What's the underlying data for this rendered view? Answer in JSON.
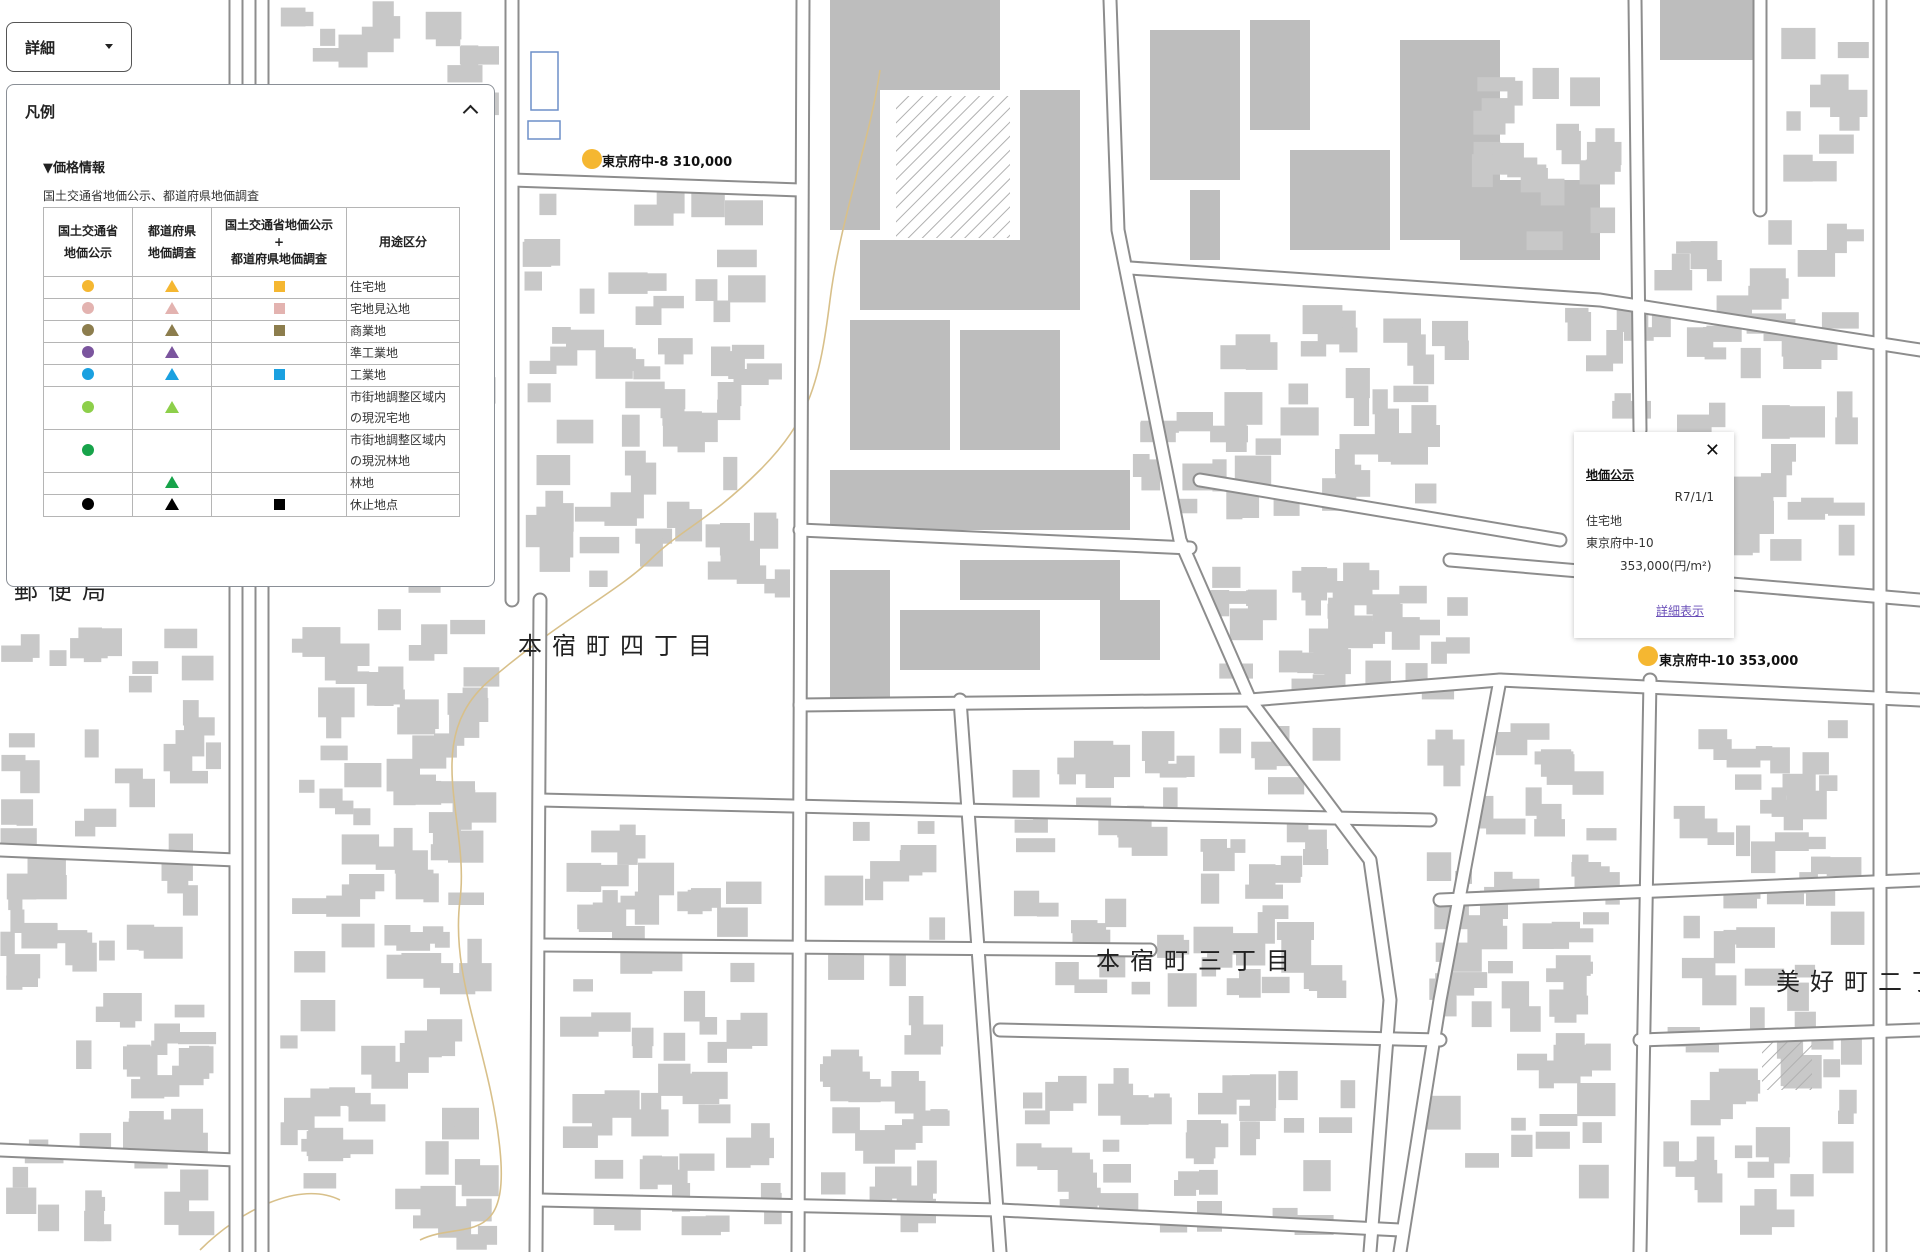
{
  "controls": {
    "detail_label": "詳細"
  },
  "legend": {
    "title": "凡例",
    "section_title": "▼価格情報",
    "source": "国土交通省地価公示、都道府県地価調査",
    "columns": {
      "national": [
        "国土交通省",
        "地価公示"
      ],
      "prefectural": [
        "都道府県",
        "地価調査"
      ],
      "combined": [
        "国土交通省地価公示",
        "+",
        "都道府県地価調査"
      ],
      "use": "用途区分"
    },
    "rows": [
      {
        "label": [
          "住宅地"
        ],
        "color": "#f5b731",
        "circle": true,
        "triangle": true,
        "square": true
      },
      {
        "label": [
          "宅地見込地"
        ],
        "color": "#e3b3b0",
        "circle": true,
        "triangle": true,
        "square": true
      },
      {
        "label": [
          "商業地"
        ],
        "color": "#8c7d4d",
        "circle": true,
        "triangle": true,
        "square": true
      },
      {
        "label": [
          "準工業地"
        ],
        "color": "#7b559e",
        "circle": true,
        "triangle": true,
        "square": false
      },
      {
        "label": [
          "工業地"
        ],
        "color": "#1aa0e0",
        "circle": true,
        "triangle": true,
        "square": true
      },
      {
        "label": [
          "市街地調整区域内",
          "の現況宅地"
        ],
        "color": "#8dcf4a",
        "circle": true,
        "triangle": true,
        "square": false
      },
      {
        "label": [
          "市街地調整区域内",
          "の現況林地"
        ],
        "color": "#17a34a",
        "circle": true,
        "triangle": false,
        "square": false
      },
      {
        "label": [
          "林地"
        ],
        "color": "#17a34a",
        "circle": false,
        "triangle": true,
        "square": false
      },
      {
        "label": [
          "休止地点"
        ],
        "color": "#000000",
        "circle": true,
        "triangle": true,
        "square": true
      }
    ]
  },
  "markers": [
    {
      "id": "東京府中-8",
      "price": "310,000"
    },
    {
      "id": "東京府中-10",
      "price": "353,000"
    }
  ],
  "popup": {
    "title": "地価公示",
    "date": "R7/1/1",
    "use": "住宅地",
    "id": "東京府中-10",
    "price": "353,000(円/m²)",
    "detail_link": "詳細表示",
    "close_icon": "close-icon"
  },
  "town_labels": [
    "本宿町四丁目",
    "本宿町三丁目",
    "美好町二丁",
    "郵便局"
  ],
  "colors": {
    "road_outline": "#8d8d8d",
    "building": "#c8c8c8",
    "marker": "#f5b731",
    "stream": "#d8c08a"
  }
}
